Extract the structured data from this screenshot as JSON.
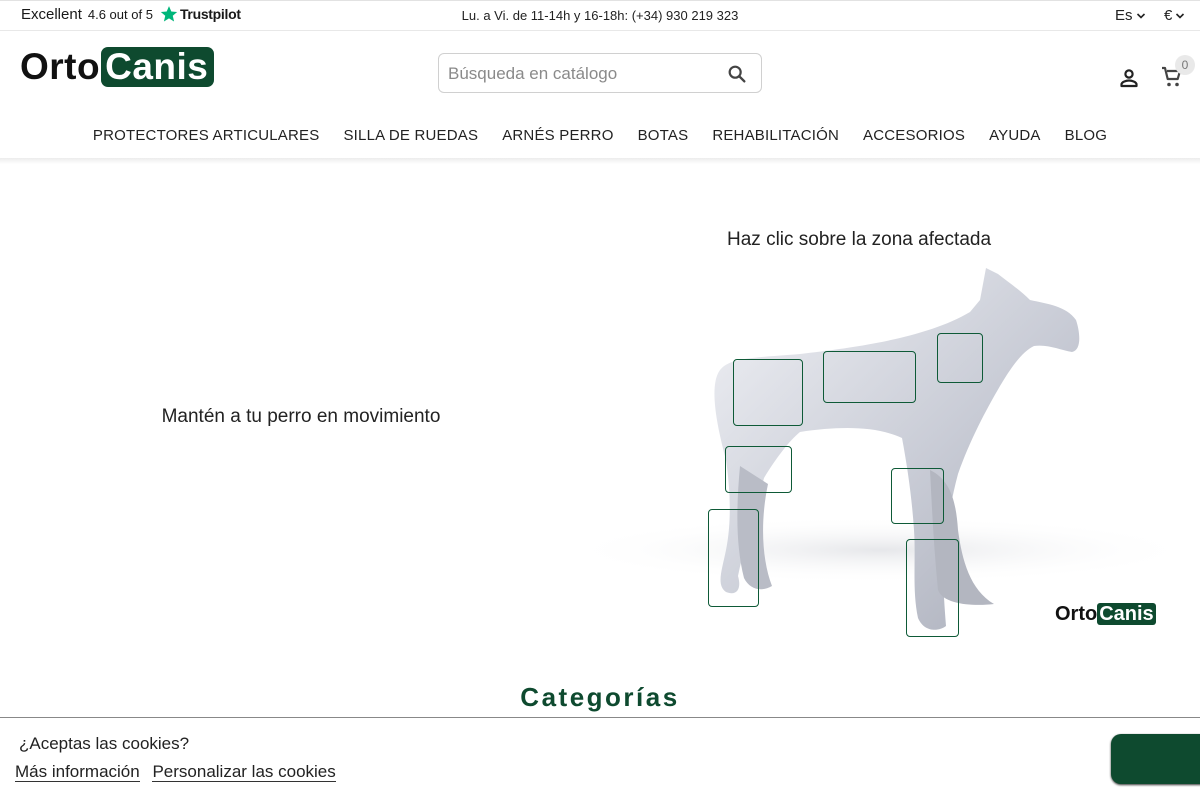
{
  "topbar": {
    "trustpilot_excellent": "Excellent",
    "trustpilot_rating": "4.6 out of 5",
    "trustpilot_brand": "Trustpilot",
    "hours": "Lu. a Vi. de 11-14h y 16-18h: (+34) 930 219 323",
    "language": "Es",
    "currency": "€"
  },
  "header": {
    "logo_part1": "Orto",
    "logo_part2": "Canis",
    "search_placeholder": "Búsqueda en catálogo",
    "cart_count": "0"
  },
  "nav": {
    "items": [
      "PROTECTORES ARTICULARES",
      "SILLA DE RUEDAS",
      "ARNÉS PERRO",
      "BOTAS",
      "REHABILITACIÓN",
      "ACCESORIOS",
      "AYUDA",
      "BLOG"
    ]
  },
  "hero": {
    "tagline": "Mantén a tu perro en movimiento",
    "hint": "Haz clic sobre la zona afectada",
    "logo_part1": "Orto",
    "logo_part2": "Canis"
  },
  "categories_title": "Categorías",
  "cookie": {
    "question": "¿Aceptas las cookies?",
    "more_info": "Más información",
    "customize": "Personalizar las cookies"
  },
  "colors": {
    "brand_green": "#0e4a2f",
    "trustpilot_green": "#00b67a"
  }
}
